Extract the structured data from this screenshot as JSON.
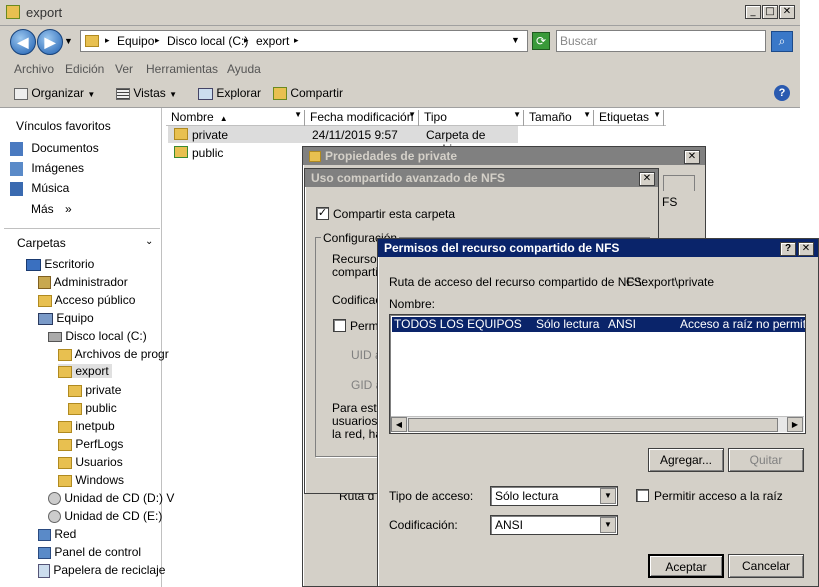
{
  "explorer": {
    "title": "export",
    "breadcrumb": [
      "Equipo",
      "Disco local (C:)",
      "export"
    ],
    "search_placeholder": "Buscar",
    "menu": [
      "Archivo",
      "Edición",
      "Ver",
      "Herramientas",
      "Ayuda"
    ],
    "toolbar": {
      "organize": "Organizar",
      "views": "Vistas",
      "explore": "Explorar",
      "share": "Compartir"
    },
    "favorites_label": "Vínculos favoritos",
    "favorites": [
      "Documentos",
      "Imágenes",
      "Música"
    ],
    "more_label": "Más",
    "folders_label": "Carpetas",
    "tree": [
      {
        "label": "Escritorio",
        "icon": "desktop-icon"
      },
      {
        "label": "Administrador",
        "icon": "user-folder-icon"
      },
      {
        "label": "Acceso público",
        "icon": "folder-icon"
      },
      {
        "label": "Equipo",
        "icon": "computer-icon"
      },
      {
        "label": "Disco local (C:)",
        "icon": "drive-icon"
      },
      {
        "label": "Archivos de progr",
        "icon": "folder-icon"
      },
      {
        "label": "export",
        "icon": "folder-icon"
      },
      {
        "label": "private",
        "icon": "folder-icon"
      },
      {
        "label": "public",
        "icon": "folder-icon"
      },
      {
        "label": "inetpub",
        "icon": "folder-icon"
      },
      {
        "label": "PerfLogs",
        "icon": "folder-icon"
      },
      {
        "label": "Usuarios",
        "icon": "folder-icon"
      },
      {
        "label": "Windows",
        "icon": "folder-icon"
      },
      {
        "label": "Unidad de CD (D:) V",
        "icon": "cd-icon"
      },
      {
        "label": "Unidad de CD (E:)",
        "icon": "cd-icon"
      },
      {
        "label": "Red",
        "icon": "network-icon"
      },
      {
        "label": "Panel de control",
        "icon": "control-panel-icon"
      },
      {
        "label": "Papelera de reciclaje",
        "icon": "recycle-bin-icon"
      }
    ],
    "columns": [
      "Nombre",
      "Fecha modificación",
      "Tipo",
      "Tamaño",
      "Etiquetas"
    ],
    "files": [
      {
        "name": "private",
        "date": "24/11/2015 9:57",
        "type": "Carpeta de archi..."
      },
      {
        "name": "public",
        "date": "",
        "type": ""
      }
    ]
  },
  "props_dialog": {
    "title": "Propiedades de private",
    "partial_text": "FS",
    "partial_text2": "Ruta d"
  },
  "nfs_dialog": {
    "title": "Uso compartido avanzado de NFS",
    "share_checkbox": "Compartir esta carpeta",
    "group_label": "Configuración",
    "partial_lines": [
      "Recurso",
      "compartic"
    ],
    "encoding_partial": "Codificac",
    "allow_partial": "Permi",
    "uid_partial": "UID a",
    "gid_partial": "GID a",
    "para_partial": [
      "Para esta",
      "usuarios",
      "la red, ha"
    ]
  },
  "perm_dialog": {
    "title": "Permisos del recurso compartido de NFS",
    "path_label": "Ruta de acceso del recurso compartido de NFS:",
    "path_value": "C:\\export\\private",
    "name_label": "Nombre:",
    "entries": [
      {
        "name": "TODOS LOS EQUIPOS",
        "access": "Sólo lectura",
        "encoding": "ANSI",
        "root": "Acceso a raíz no permitido"
      }
    ],
    "add_button": "Agregar...",
    "remove_button": "Quitar",
    "access_type_label": "Tipo de acceso:",
    "access_type_value": "Sólo lectura",
    "allow_root_label": "Permitir acceso a la raíz",
    "encoding_label": "Codificación:",
    "encoding_value": "ANSI",
    "ok_button": "Aceptar",
    "cancel_button": "Cancelar"
  }
}
